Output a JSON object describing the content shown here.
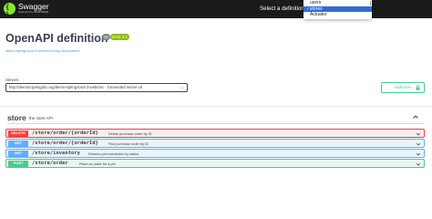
{
  "topbar": {
    "logo_text": "Swagger",
    "logo_sub": "Supported by SMARTBEAR",
    "definition_label": "Select a definition"
  },
  "definition_dropdown": {
    "options": [
      "users",
      "stores",
      "Actuator"
    ],
    "selected": "stores",
    "check_glyph": "✓"
  },
  "info": {
    "title": "OpenAPI definition",
    "version": "v0",
    "oas_badge": "OAS 3.1",
    "spec_url": "/demo-spring-boot-3-webmvc/v3/api-docs/stores"
  },
  "servers": {
    "label": "Servers",
    "selected": "http://demos.springdoc.org/demo-spring-boot-3-webmvc - Generated server url"
  },
  "authorize": {
    "label": "Authorize"
  },
  "tag": {
    "name": "store",
    "description": "the store API",
    "expanded": true
  },
  "operations": [
    {
      "method": "DELETE",
      "path": "/store/order/{orderId}",
      "summary": "Delete purchase order by ID"
    },
    {
      "method": "GET",
      "path": "/store/order/{orderId}",
      "summary": "Find purchase order by ID"
    },
    {
      "method": "GET",
      "path": "/store/inventory",
      "summary": "Returns pet inventories by status"
    },
    {
      "method": "POST",
      "path": "/store/order",
      "summary": "Place an order for a pet"
    }
  ],
  "colors": {
    "topbar": "#1b1b1b",
    "delete": "#f93e3e",
    "get": "#61affe",
    "post": "#49cc90",
    "authorize": "#49cc90",
    "dropdown_selected": "#2b6fd6"
  }
}
